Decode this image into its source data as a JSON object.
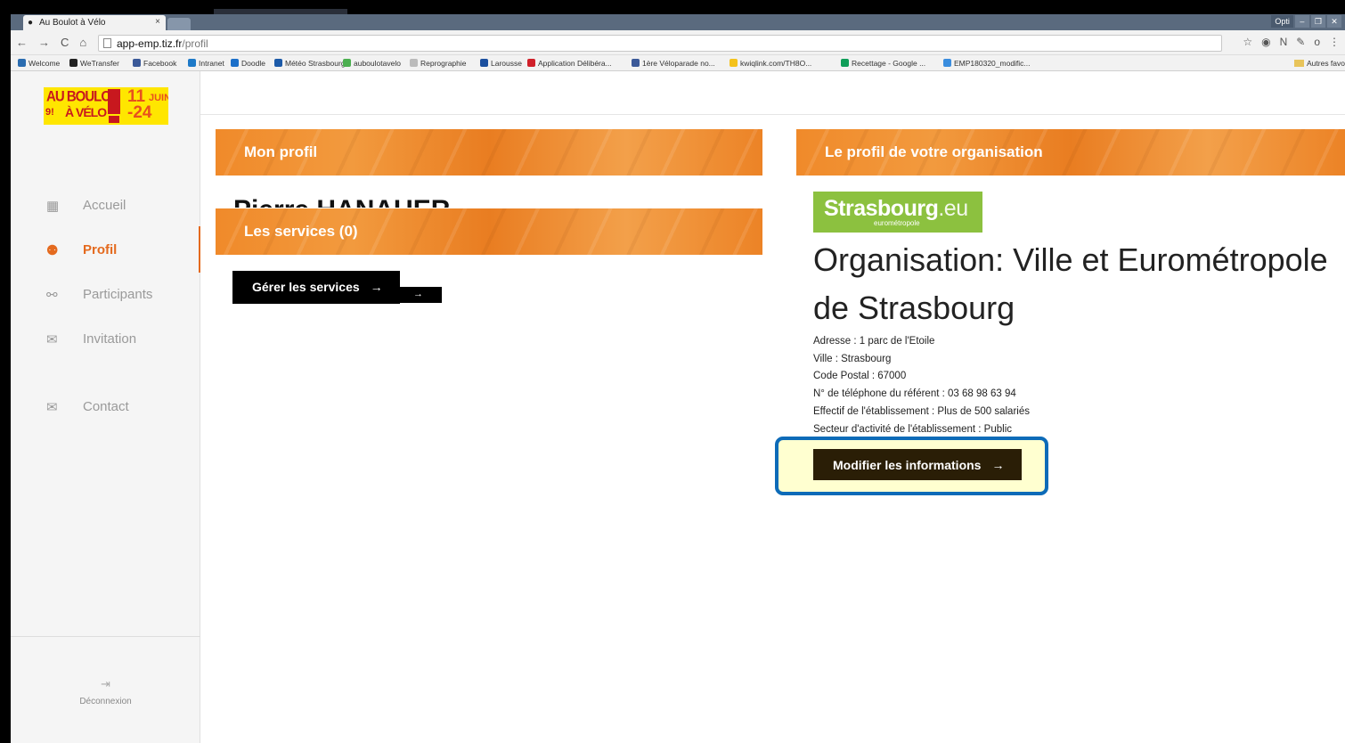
{
  "browser": {
    "tab_title": "Au Boulot à Vélo",
    "tab_close": "×",
    "favicon": "bike-icon",
    "window_buttons": [
      "Opti",
      "–",
      "❐",
      "✕"
    ],
    "nav_icons": [
      "←",
      "→",
      "C",
      "⌂"
    ],
    "url_host": "app-emp.tiz.fr",
    "url_path": "/profil",
    "extension_icons": [
      "☆",
      "◉",
      "N",
      "✎",
      "o",
      "⋮"
    ],
    "bookmarks": [
      {
        "label": "Welcome",
        "color": "#2a6cb0"
      },
      {
        "label": "WeTransfer",
        "color": "#222222"
      },
      {
        "label": "Facebook",
        "color": "#3b5998"
      },
      {
        "label": "Intranet",
        "color": "#1e7ac8"
      },
      {
        "label": "Doodle",
        "color": "#1b6fc9"
      },
      {
        "label": "Météo Strasbourg",
        "color": "#1c5aa8"
      },
      {
        "label": "auboulotavelo",
        "color": "#4caf50"
      },
      {
        "label": "Reprographie",
        "color": "#bbbbbb"
      },
      {
        "label": "Larousse",
        "color": "#1b4f9e"
      },
      {
        "label": "Application Délibéra...",
        "color": "#d0202a"
      },
      {
        "label": "1ère Véloparade no...",
        "color": "#3b5998"
      },
      {
        "label": "kwiqlink.com/TH8O...",
        "color": "#f4c21b"
      },
      {
        "label": "Recettage - Google ...",
        "color": "#0f9d58"
      },
      {
        "label": "EMP180320_modific...",
        "color": "#3a8dde"
      }
    ],
    "other_bookmarks": "Autres favo"
  },
  "logo": {
    "line1": "AU BOULOT",
    "line2": "À VÉLO",
    "prefix": "9!",
    "date1": "11",
    "month": "JUIN",
    "date2": "-24"
  },
  "sidebar": {
    "items": [
      {
        "label": "Accueil",
        "icon": "grid-icon",
        "glyph": "▦"
      },
      {
        "label": "Profil",
        "icon": "users-icon",
        "glyph": "⚉"
      },
      {
        "label": "Participants",
        "icon": "bicycle-icon",
        "glyph": "⚯"
      },
      {
        "label": "Invitation",
        "icon": "mail-icon",
        "glyph": "✉"
      },
      {
        "label": "Contact",
        "icon": "mail-icon",
        "glyph": "✉"
      }
    ],
    "logout_label": "Déconnexion",
    "logout_glyph": "⇥"
  },
  "main": {
    "mon_profil_title": "Mon profil",
    "clipped_name": "Pierre HANAUER",
    "services_title": "Les services (0)",
    "manage_services_button": "Gérer les services",
    "arrow": "→",
    "org_section_title": "Le profil de votre organisation",
    "org_logo_word": "Strasbourg",
    "org_logo_suffix": ".eu",
    "org_logo_sub": "eurométropole",
    "org_title": "Organisation: Ville et Eurométropole de Strasbourg",
    "org_info": [
      "Adresse : 1 parc de l'Etoile",
      "Ville : Strasbourg",
      "Code Postal : 67000",
      "N° de téléphone du référent : 03 68 98 63 94",
      "Effectif de l'établissement : Plus de 500 salariés",
      "Secteur d'activité de l'établissement : Public"
    ],
    "modify_button": "Modifier les informations"
  },
  "colors": {
    "accent": "#e46a1e",
    "banner": "#f08a2a",
    "highlight_border": "#0d6bb8",
    "highlight_bg": "#ffffd0",
    "org_green": "#8cc13f"
  }
}
